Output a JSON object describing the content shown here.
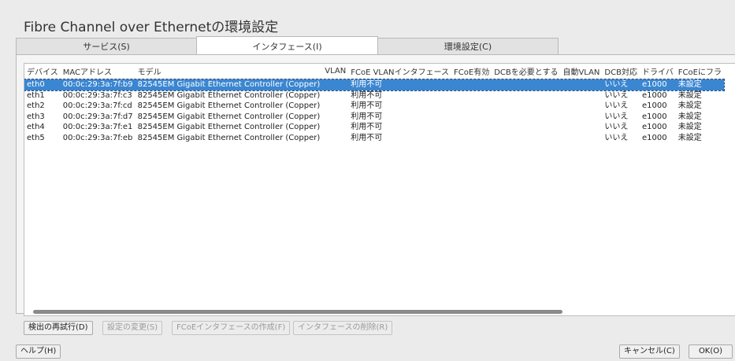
{
  "window": {
    "title": "Fibre Channel over Ethernetの環境設定"
  },
  "tabs": [
    {
      "label": "サービス(S)"
    },
    {
      "label": "インタフェース(I)"
    },
    {
      "label": "環境設定(C)"
    }
  ],
  "table": {
    "columns": [
      "デバイス",
      "MACアドレス",
      "モデル",
      "VLAN",
      "FCoE VLANインタフェース",
      "FCoE有効",
      "DCBを必要とする",
      "自動VLAN",
      "DCB対応",
      "ドライバ",
      "FCoEにフラ"
    ],
    "rows": [
      [
        "eth0",
        "00:0c:29:3a:7f:b9",
        "82545EM Gigabit Ethernet Controller (Copper)",
        "",
        "利用不可",
        "",
        "",
        "",
        "いいえ",
        "e1000",
        "未設定"
      ],
      [
        "eth1",
        "00:0c:29:3a:7f:c3",
        "82545EM Gigabit Ethernet Controller (Copper)",
        "",
        "利用不可",
        "",
        "",
        "",
        "いいえ",
        "e1000",
        "未設定"
      ],
      [
        "eth2",
        "00:0c:29:3a:7f:cd",
        "82545EM Gigabit Ethernet Controller (Copper)",
        "",
        "利用不可",
        "",
        "",
        "",
        "いいえ",
        "e1000",
        "未設定"
      ],
      [
        "eth3",
        "00:0c:29:3a:7f:d7",
        "82545EM Gigabit Ethernet Controller (Copper)",
        "",
        "利用不可",
        "",
        "",
        "",
        "いいえ",
        "e1000",
        "未設定"
      ],
      [
        "eth4",
        "00:0c:29:3a:7f:e1",
        "82545EM Gigabit Ethernet Controller (Copper)",
        "",
        "利用不可",
        "",
        "",
        "",
        "いいえ",
        "e1000",
        "未設定"
      ],
      [
        "eth5",
        "00:0c:29:3a:7f:eb",
        "82545EM Gigabit Ethernet Controller (Copper)",
        "",
        "利用不可",
        "",
        "",
        "",
        "いいえ",
        "e1000",
        "未設定"
      ]
    ]
  },
  "buttons": {
    "retry": "検出の再試行(D)",
    "change": "設定の変更(S)",
    "create": "FCoEインタフェースの作成(F)",
    "remove": "インタフェースの削除(R)",
    "help": "ヘルプ(H)",
    "cancel": "キャンセル(C)",
    "ok": "OK(O)"
  }
}
